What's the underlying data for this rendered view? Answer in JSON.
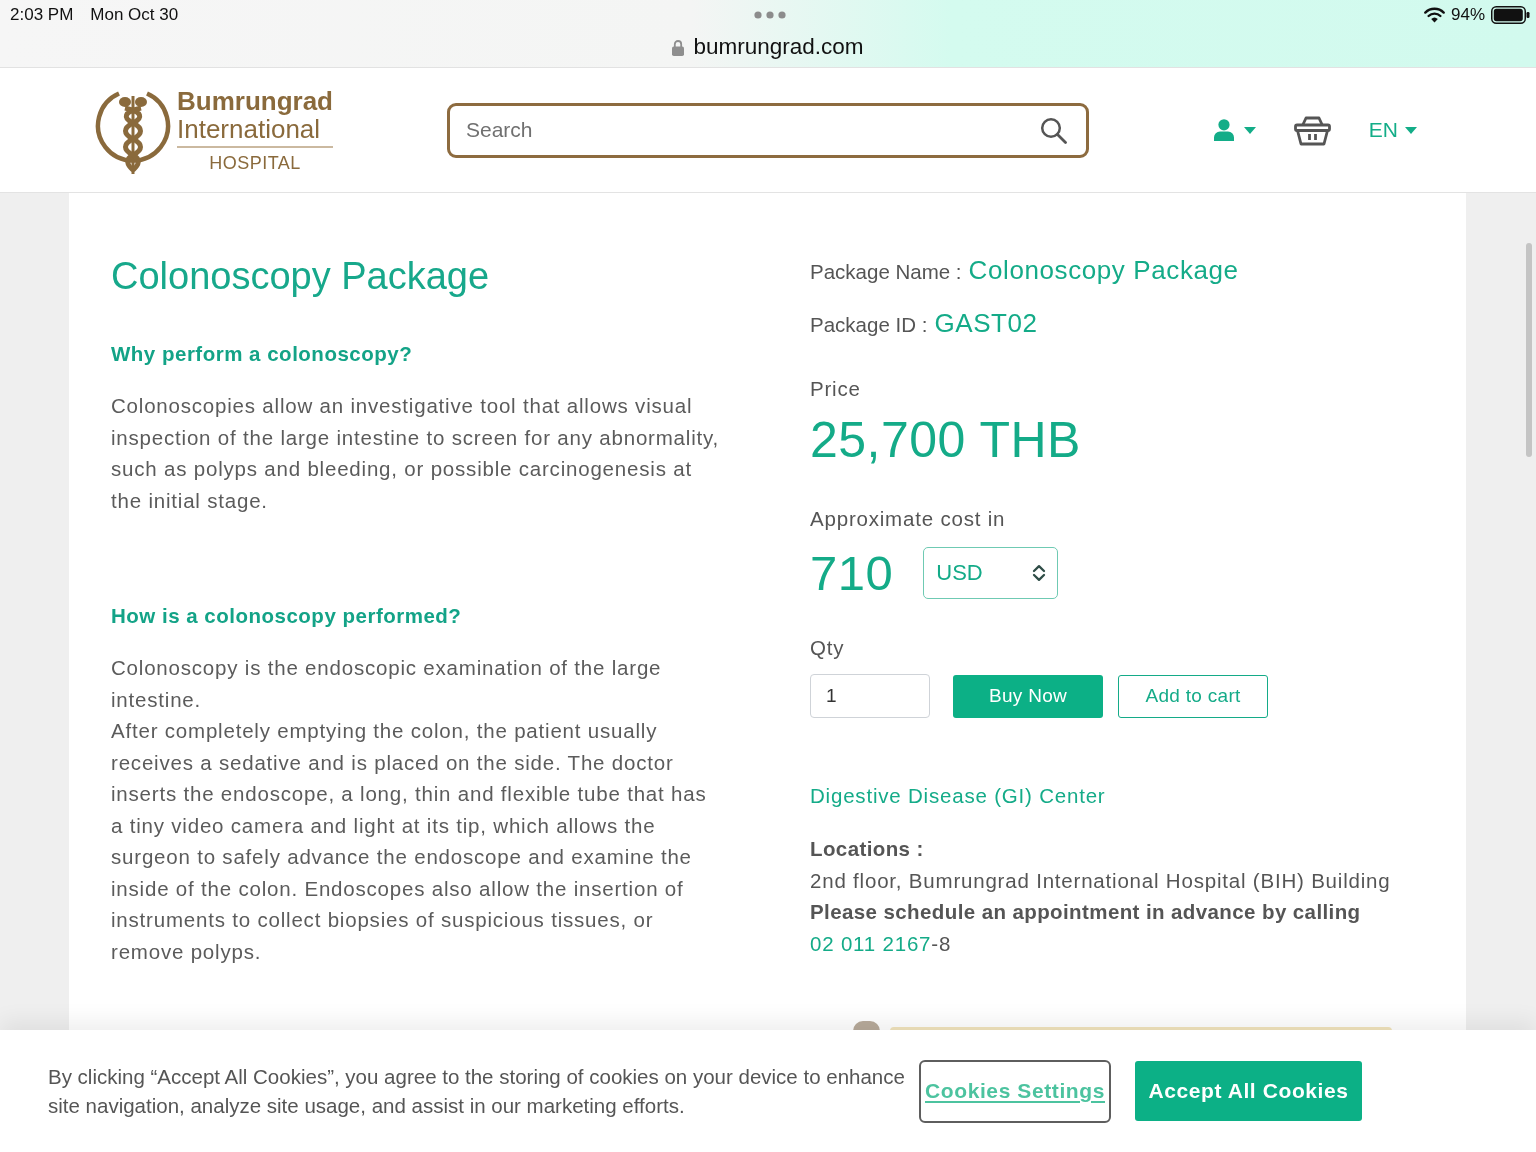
{
  "status_bar": {
    "time": "2:03 PM",
    "date": "Mon Oct 30",
    "battery": "94%"
  },
  "browser": {
    "url": "bumrungrad.com"
  },
  "header": {
    "logo": {
      "name": "Bumrungrad",
      "subtitle": "International",
      "tagline": "HOSPITAL"
    },
    "search": {
      "placeholder": "Search"
    },
    "language": "EN"
  },
  "article": {
    "title": "Colonoscopy Package",
    "sections": [
      {
        "heading": "Why perform a colonoscopy?",
        "paragraphs": [
          "Colonoscopies allow an investigative tool that allows visual inspection of the large intestine to screen for any abnormality, such as polyps and bleeding, or possible carcinogenesis at the initial stage."
        ]
      },
      {
        "heading": "How is a colonoscopy performed?",
        "paragraphs": [
          "Colonoscopy is the endoscopic examination of the large intestine.",
          "After completely emptying the colon, the patient usually receives a sedative and is placed on the side. The doctor inserts the endoscope, a long, thin and flexible tube that has a tiny video camera and light at its tip, which allows the surgeon to safely advance the endoscope and examine the inside of the colon. Endoscopes also allow the insertion of instruments to collect biopsies of suspicious tissues, or remove polyps."
        ]
      }
    ]
  },
  "package": {
    "name_label": "Package Name :",
    "name": "Colonoscopy Package",
    "id_label": "Package ID :",
    "id": "GAST02",
    "price_label": "Price",
    "price": "25,700 THB",
    "approx_label": "Approximate cost in",
    "approx_value": "710",
    "currency": "USD",
    "qty_label": "Qty",
    "qty": "1",
    "buttons": [
      {
        "label": "Buy Now",
        "kind": "primary"
      },
      {
        "label": "Add to cart",
        "kind": "outline"
      }
    ],
    "center_link": "Digestive Disease (GI) Center",
    "locations_label": "Locations :",
    "location": "2nd floor, Bumrungrad International Hospital (BIH) Building",
    "appointment": {
      "text": "Please schedule an appointment in advance by calling",
      "phone": "02 011 2167",
      "suffix": "-8"
    }
  },
  "cookie_banner": {
    "text": "By clicking “Accept All Cookies”, you agree to the storing of cookies on your device to enhance site navigation, analyze site usage, and assist in our marketing efforts.",
    "buttons": [
      {
        "label": "Cookies Settings",
        "kind": "link"
      },
      {
        "label": "Accept All Cookies",
        "kind": "primary"
      }
    ]
  }
}
